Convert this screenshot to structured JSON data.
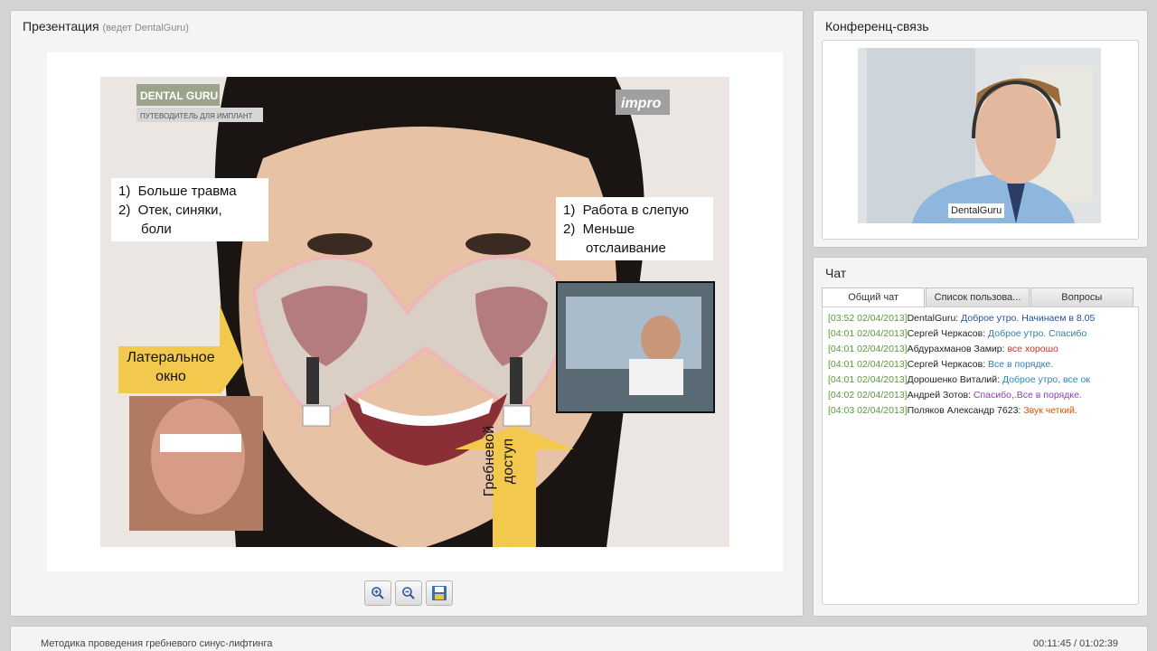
{
  "presentation": {
    "title": "Презентация",
    "subtitle": "(ведет DentalGuru)",
    "slide": {
      "logo_text": "DENTAL GURU",
      "logo_subtext": "ПУТЕВОДИТЕЛЬ ДЛЯ ИМПЛАНТ",
      "brand_right": "impro",
      "left_list": [
        "1)  Больше травма",
        "2)  Отек, синяки,",
        "      боли"
      ],
      "right_list": [
        "1)  Работа в слепую",
        "2)  Меньше",
        "      отслаивание"
      ],
      "lateral_label": [
        "Латеральное",
        "окно"
      ],
      "crest_label": [
        "Гребневой",
        "доступ"
      ]
    },
    "toolbar": {
      "zoom_in": "zoom-in-icon",
      "zoom_out": "zoom-out-icon",
      "save": "save-icon"
    }
  },
  "conference": {
    "title": "Конференц-связь",
    "video_label": "DentalGuru"
  },
  "chat": {
    "title": "Чат",
    "tabs": [
      "Общий чат",
      "Список пользова...",
      "Вопросы"
    ],
    "messages": [
      {
        "ts": "[03:52 02/04/2013]",
        "who": "DentalGuru:",
        "text": "Доброе утро. Начинаем в 8.05",
        "color": "#2a4fa8"
      },
      {
        "ts": "[04:01 02/04/2013]",
        "who": "Сергей Черкасов:",
        "text": "Доброе утро. Спасибо",
        "color": "#2e7fb0"
      },
      {
        "ts": "[04:01 02/04/2013]",
        "who": "Абдурахманов Замир:",
        "text": "все хорошо",
        "color": "#c0392b"
      },
      {
        "ts": "[04:01 02/04/2013]",
        "who": "Сергей Черкасов:",
        "text": "Все в порядке.",
        "color": "#2e7fb0"
      },
      {
        "ts": "[04:01 02/04/2013]",
        "who": "Дороshенко Виталий:",
        "text": "Доброе утро, все ок",
        "color": "#2e86b6"
      },
      {
        "ts": "[04:02 02/04/2013]",
        "who": "Андрей Зотов:",
        "text": "Спасибо,.Все в порядке.",
        "color": "#8e3fa8"
      },
      {
        "ts": "[04:03 02/04/2013]",
        "who": "Поляков Александр 7623:",
        "text": "Звук четкий.",
        "color": "#d35400"
      }
    ]
  },
  "footer": {
    "title": "Методика проведения гребневого синус-лифтинга",
    "time": "00:11:45 / 01:02:39"
  }
}
